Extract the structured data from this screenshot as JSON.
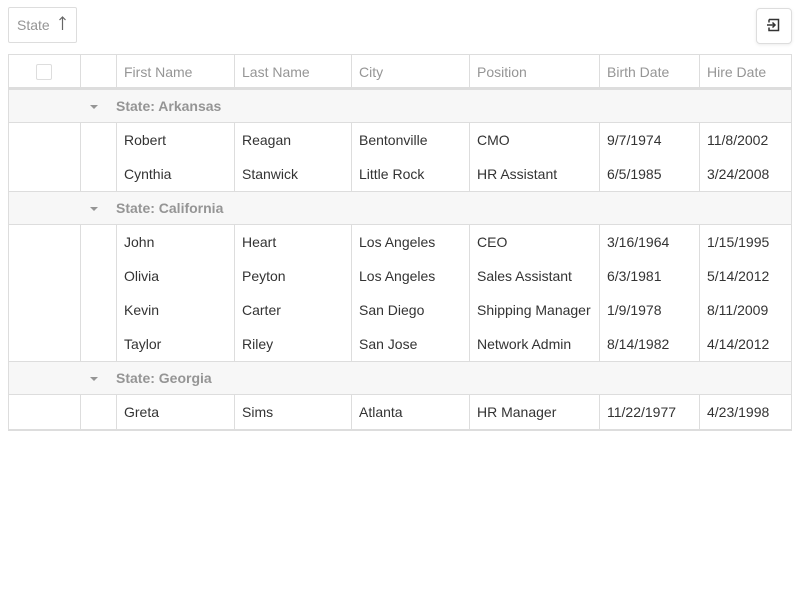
{
  "toolbar": {
    "group_chip_label": "State",
    "sort_icon": "arrow-up-icon",
    "export_icon": "export-icon"
  },
  "columns": [
    "First Name",
    "Last Name",
    "City",
    "Position",
    "Birth Date",
    "Hire Date"
  ],
  "groups": [
    {
      "title": "State: Arkansas",
      "rows": [
        [
          "Robert",
          "Reagan",
          "Bentonville",
          "CMO",
          "9/7/1974",
          "11/8/2002"
        ],
        [
          "Cynthia",
          "Stanwick",
          "Little Rock",
          "HR Assistant",
          "6/5/1985",
          "3/24/2008"
        ]
      ]
    },
    {
      "title": "State: California",
      "rows": [
        [
          "John",
          "Heart",
          "Los Angeles",
          "CEO",
          "3/16/1964",
          "1/15/1995"
        ],
        [
          "Olivia",
          "Peyton",
          "Los Angeles",
          "Sales Assistant",
          "6/3/1981",
          "5/14/2012"
        ],
        [
          "Kevin",
          "Carter",
          "San Diego",
          "Shipping Manager",
          "1/9/1978",
          "8/11/2009"
        ],
        [
          "Taylor",
          "Riley",
          "San Jose",
          "Network Admin",
          "8/14/1982",
          "4/14/2012"
        ]
      ]
    },
    {
      "title": "State: Georgia",
      "rows": [
        [
          "Greta",
          "Sims",
          "Atlanta",
          "HR Manager",
          "11/22/1977",
          "4/23/1998"
        ]
      ]
    }
  ],
  "colors": {
    "border": "#dddddd",
    "header_text": "#959595",
    "group_bg": "#f7f7f7",
    "cell_text": "#333333"
  }
}
